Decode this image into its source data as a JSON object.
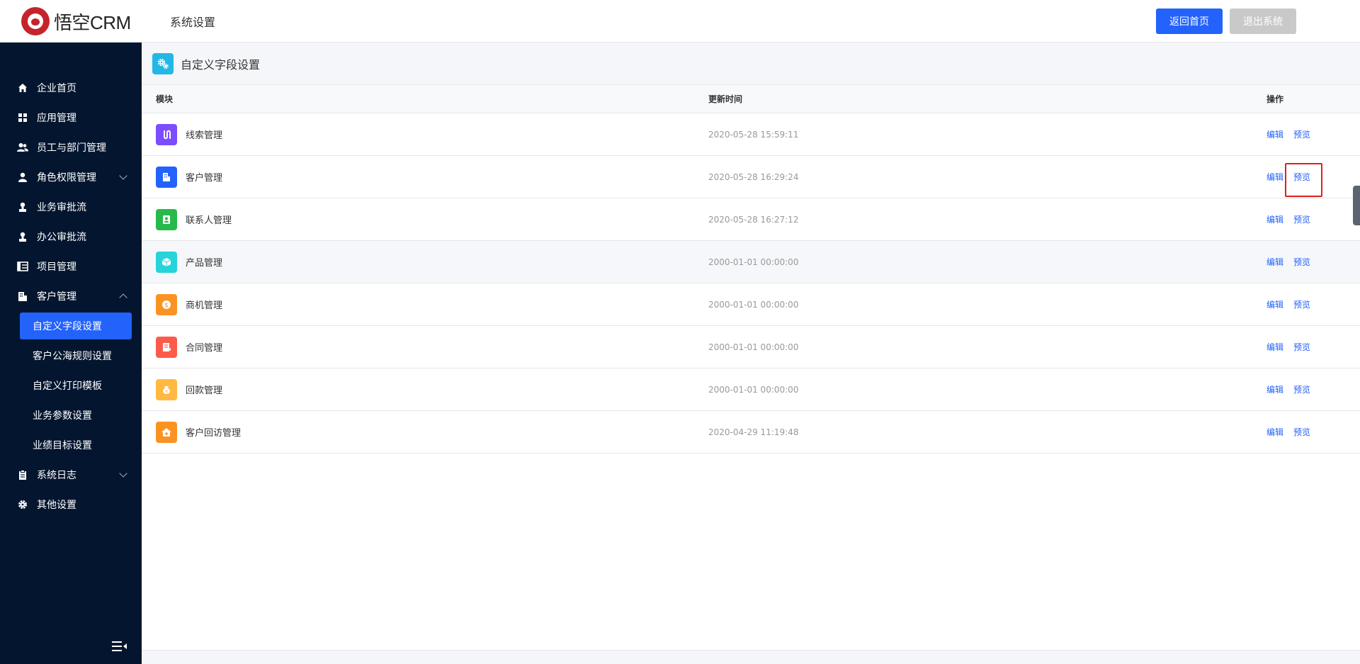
{
  "header": {
    "logo_text": "悟空CRM",
    "title": "系统设置",
    "home_button": "返回首页",
    "exit_button": "退出系统"
  },
  "sidebar": {
    "items": [
      {
        "label": "企业首页",
        "icon": "home-icon"
      },
      {
        "label": "应用管理",
        "icon": "grid-icon"
      },
      {
        "label": "员工与部门管理",
        "icon": "users-icon"
      },
      {
        "label": "角色权限管理",
        "icon": "user-icon"
      },
      {
        "label": "业务审批流",
        "icon": "approval-icon"
      },
      {
        "label": "办公审批流",
        "icon": "approval-icon"
      },
      {
        "label": "项目管理",
        "icon": "project-icon"
      },
      {
        "label": "客户管理",
        "icon": "building-icon"
      }
    ],
    "sub_items": [
      "自定义字段设置",
      "客户公海规则设置",
      "自定义打印模板",
      "业务参数设置",
      "业绩目标设置"
    ],
    "bottom_items": [
      {
        "label": "系统日志",
        "icon": "log-icon"
      },
      {
        "label": "其他设置",
        "icon": "gear-icon"
      }
    ]
  },
  "page": {
    "title": "自定义字段设置"
  },
  "table": {
    "columns": {
      "module": "模块",
      "time": "更新时间",
      "action": "操作"
    },
    "edit_label": "编辑",
    "preview_label": "预览",
    "rows": [
      {
        "name": "线索管理",
        "time": "2020-05-28 15:59:11",
        "color": "#7c4dff",
        "icon": "leads-icon"
      },
      {
        "name": "客户管理",
        "time": "2020-05-28 16:29:24",
        "color": "#2362fb",
        "icon": "customer-icon"
      },
      {
        "name": "联系人管理",
        "time": "2020-05-28 16:27:12",
        "color": "#27ba4a",
        "icon": "contact-icon"
      },
      {
        "name": "产品管理",
        "time": "2000-01-01 00:00:00",
        "color": "#26d4da",
        "icon": "product-icon"
      },
      {
        "name": "商机管理",
        "time": "2000-01-01 00:00:00",
        "color": "#fb9323",
        "icon": "business-icon"
      },
      {
        "name": "合同管理",
        "time": "2000-01-01 00:00:00",
        "color": "#fd5b4a",
        "icon": "contract-icon"
      },
      {
        "name": "回款管理",
        "time": "2000-01-01 00:00:00",
        "color": "#ffb940",
        "icon": "payment-icon"
      },
      {
        "name": "客户回访管理",
        "time": "2020-04-29 11:19:48",
        "color": "#fb9323",
        "icon": "visit-icon"
      }
    ]
  }
}
